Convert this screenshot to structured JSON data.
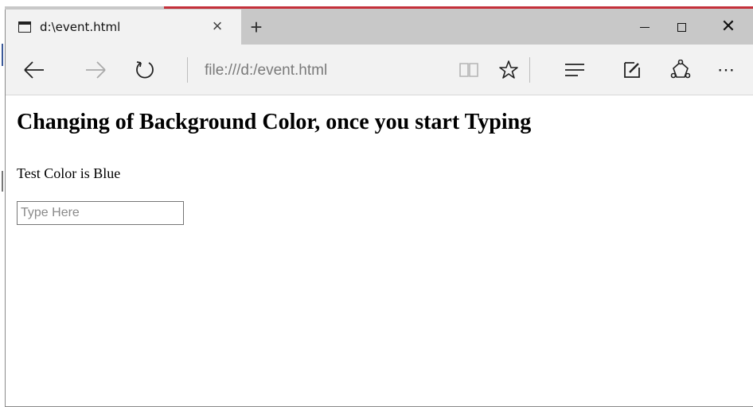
{
  "tab": {
    "title": "d:\\event.html",
    "close_glyph": "×",
    "new_tab_glyph": "+"
  },
  "window_controls": {
    "close_glyph": "✕"
  },
  "toolbar": {
    "address": "file:///d:/event.html",
    "more_glyph": "⋯"
  },
  "icons": {
    "tab": "page-icon",
    "back": "arrow-left-icon",
    "forward": "arrow-right-icon",
    "refresh": "refresh-icon",
    "reading_view": "book-icon",
    "favorite": "star-icon",
    "hub": "hub-icon",
    "web_note": "pen-icon",
    "share": "share-icon",
    "more": "ellipsis-icon"
  },
  "page": {
    "heading": "Changing of Background Color, once you start Typing",
    "status": "Test Color is Blue",
    "input_placeholder": "Type Here",
    "input_value": ""
  },
  "colors": {
    "tabbar": "#c8c8c8",
    "toolbar": "#f2f2f2",
    "accent_red": "#c4303a"
  }
}
